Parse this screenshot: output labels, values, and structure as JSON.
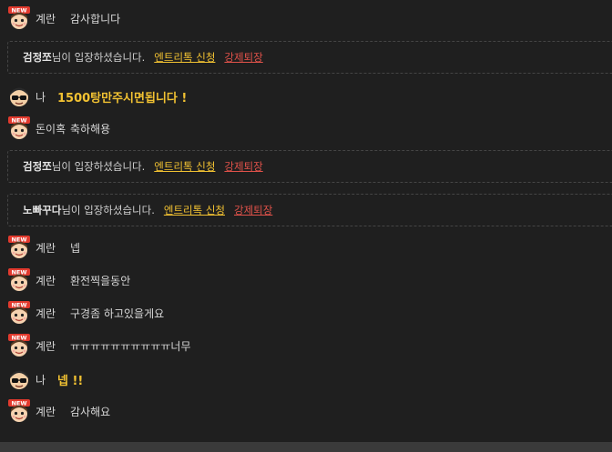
{
  "messages": [
    {
      "type": "user",
      "avatar": "new-badge-face",
      "name": "계란",
      "text": "감사합니다"
    },
    {
      "type": "system",
      "who": "검정쪼",
      "suffix": "님이 입장하셨습니다.",
      "entry_label": "엔트리톡 신청",
      "kick_label": "강제퇴장"
    },
    {
      "type": "me",
      "avatar": "sunglasses-face",
      "name": "나",
      "text": "1500탕만주시면됩니다 !"
    },
    {
      "type": "user",
      "avatar": "new-badge-face",
      "name": "돈이혹",
      "text": "축하해용"
    },
    {
      "type": "system",
      "who": "검정쪼",
      "suffix": "님이 입장하셨습니다.",
      "entry_label": "엔트리톡 신청",
      "kick_label": "강제퇴장"
    },
    {
      "type": "system",
      "who": "노빠꾸다",
      "suffix": "님이 입장하셨습니다.",
      "entry_label": "엔트리톡 신청",
      "kick_label": "강제퇴장"
    },
    {
      "type": "user",
      "avatar": "new-badge-face",
      "name": "계란",
      "text": "넵"
    },
    {
      "type": "user",
      "avatar": "new-badge-face",
      "name": "계란",
      "text": "환전찍을동안"
    },
    {
      "type": "user",
      "avatar": "new-badge-face",
      "name": "계란",
      "text": "구경좀 하고있을게요"
    },
    {
      "type": "user",
      "avatar": "new-badge-face",
      "name": "계란",
      "text": "ㅠㅠㅠㅠㅠㅠㅠㅠㅠㅠ너무"
    },
    {
      "type": "me",
      "avatar": "sunglasses-face",
      "name": "나",
      "text": "넵 !!"
    },
    {
      "type": "user",
      "avatar": "new-badge-face",
      "name": "계란",
      "text": "감사해요"
    }
  ],
  "badge_text": "NEW",
  "colors": {
    "background": "#1f1f1f",
    "highlight": "#f2c232",
    "kick": "#e0524a",
    "dashed_border": "#454545"
  }
}
